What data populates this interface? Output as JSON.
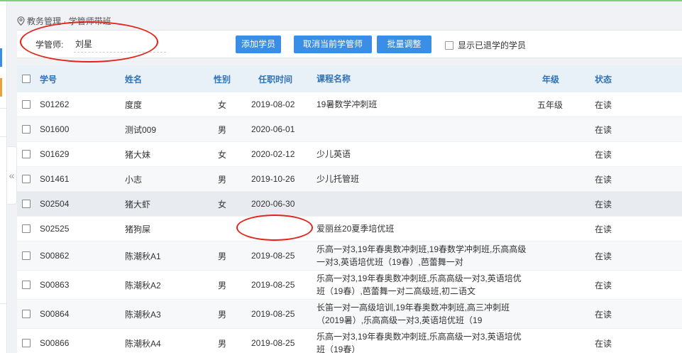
{
  "breadcrumb": "教务管理 · 学管师带班",
  "toolbar": {
    "tutor_label": "学管师:",
    "tutor_value": "刘星",
    "add_label": "添加学员",
    "cancel_label": "取消当前学管师",
    "batch_label": "批量调整",
    "show_withdrawn_label": "显示已退学的学员"
  },
  "table": {
    "headers": {
      "id": "学号",
      "name": "姓名",
      "sex": "性别",
      "date": "任职时间",
      "course": "课程名称",
      "grade": "年级",
      "status": "状态"
    },
    "rows": [
      {
        "id": "S01262",
        "name": "度度",
        "sex": "女",
        "date": "2019-08-02",
        "course": "19暑数学冲刺班",
        "grade": "五年级",
        "status": "在读"
      },
      {
        "id": "S01600",
        "name": "测试009",
        "sex": "男",
        "date": "2020-06-01",
        "course": "",
        "grade": "",
        "status": "在读"
      },
      {
        "id": "S01629",
        "name": "猪大妹",
        "sex": "女",
        "date": "2020-02-12",
        "course": "少儿英语",
        "grade": "",
        "status": "在读"
      },
      {
        "id": "S01461",
        "name": "小志",
        "sex": "男",
        "date": "2019-10-26",
        "course": "少儿托管班",
        "grade": "",
        "status": "在读"
      },
      {
        "id": "S02504",
        "name": "猪大虾",
        "sex": "女",
        "date": "2020-06-30",
        "course": "",
        "grade": "",
        "status": "在读"
      },
      {
        "id": "S02525",
        "name": "猪狗屎",
        "sex": "",
        "date": "",
        "course": "爱丽丝20夏季培优班",
        "grade": "",
        "status": "在读"
      },
      {
        "id": "S00862",
        "name": "陈潮秋A1",
        "sex": "男",
        "date": "2019-08-25",
        "course": "乐高一对3,19年春奥数冲刺班,19春数学冲刺班,乐高高级一对3,英语培优班（19春）,芭蕾舞一对",
        "grade": "",
        "status": "在读"
      },
      {
        "id": "S00863",
        "name": "陈潮秋A2",
        "sex": "男",
        "date": "2019-08-25",
        "course": "乐高一对3,19年春奥数冲刺班,乐高高级一对3,英语培优班（19春）,芭蕾舞一对二高级班,初二语文",
        "grade": "",
        "status": "在读"
      },
      {
        "id": "S00864",
        "name": "陈潮秋A3",
        "sex": "男",
        "date": "2019-08-25",
        "course": "长笛一对一高级培训,19年春奥数冲刺班,高三冲刺班（2019暑）,乐高高级一对3,英语培优班（19",
        "grade": "",
        "status": "在读"
      },
      {
        "id": "S00866",
        "name": "陈潮秋A4",
        "sex": "男",
        "date": "2019-08-25",
        "course": "乐高一对3,19年春奥数冲刺班,乐高高级一对3,英语培优班（19春）",
        "grade": "",
        "status": "在读"
      }
    ]
  },
  "colors": {
    "accent": "#3a8ee6",
    "header_text": "#2f72b5",
    "annotation": "#e3241b"
  }
}
